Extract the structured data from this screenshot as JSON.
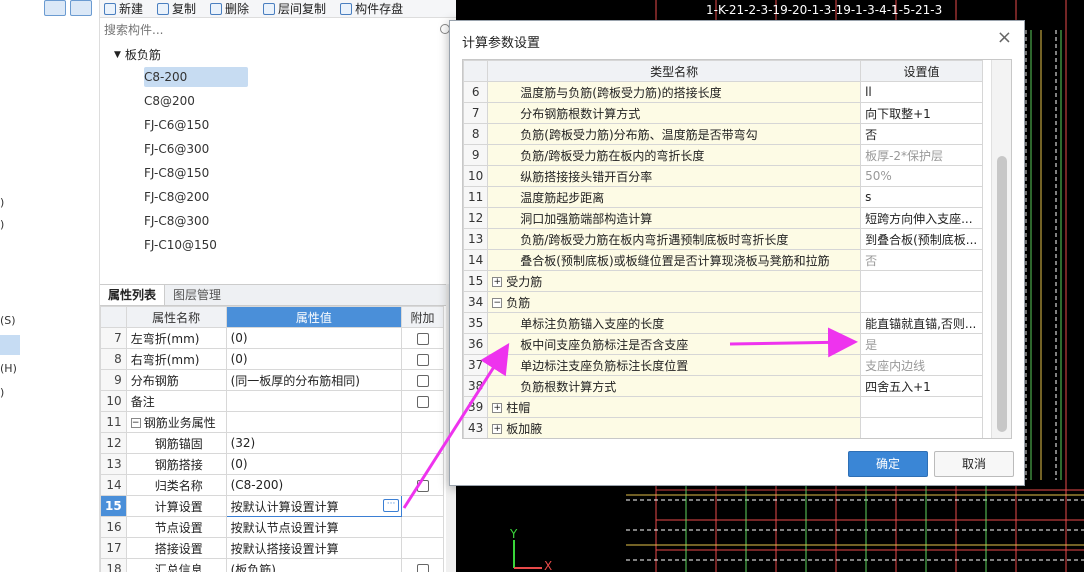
{
  "left_strip": {
    "labels": [
      ")",
      ")",
      "(S)",
      "(H)",
      ")"
    ]
  },
  "toolbar": {
    "new_label": "新建",
    "copy_label": "复制",
    "delete_label": "删除",
    "floor_copy_label": "层间复制",
    "save_label": "构件存盘"
  },
  "search": {
    "placeholder": "搜索构件..."
  },
  "tree": {
    "root_label": "板负筋",
    "items": [
      "C8-200",
      "C8@200",
      "FJ-C6@150",
      "FJ-C6@300",
      "FJ-C8@150",
      "FJ-C8@200",
      "FJ-C8@300",
      "FJ-C10@150"
    ],
    "selected_index": 0
  },
  "props": {
    "tabs": [
      "属性列表",
      "图层管理"
    ],
    "headers": {
      "name": "属性名称",
      "value": "属性值",
      "extra": "附加"
    },
    "rows": [
      {
        "num": "7",
        "name": "左弯折(mm)",
        "value": "(0)"
      },
      {
        "num": "8",
        "name": "右弯折(mm)",
        "value": "(0)"
      },
      {
        "num": "9",
        "name": "分布钢筋",
        "value": "(同一板厚的分布筋相同)"
      },
      {
        "num": "10",
        "name": "备注",
        "value": ""
      },
      {
        "num": "11",
        "name": "钢筋业务属性",
        "value": ""
      },
      {
        "num": "12",
        "name": "钢筋锚固",
        "value": "(32)"
      },
      {
        "num": "13",
        "name": "钢筋搭接",
        "value": "(0)"
      },
      {
        "num": "14",
        "name": "归类名称",
        "value": "(C8-200)"
      },
      {
        "num": "15",
        "name": "计算设置",
        "value": "按默认计算设置计算"
      },
      {
        "num": "16",
        "name": "节点设置",
        "value": "按默认节点设置计算"
      },
      {
        "num": "17",
        "name": "搭接设置",
        "value": "按默认搭接设置计算"
      },
      {
        "num": "18",
        "name": "汇总信息",
        "value": "(板负筋)"
      }
    ],
    "ellipsis": "···"
  },
  "dialog": {
    "title": "计算参数设置",
    "close": "×",
    "headers": {
      "type": "类型名称",
      "value": "设置值"
    },
    "rows": [
      {
        "num": "6",
        "name": "温度筋与负筋(跨板受力筋)的搭接长度",
        "value": "ll"
      },
      {
        "num": "7",
        "name": "分布钢筋根数计算方式",
        "value": "向下取整+1"
      },
      {
        "num": "8",
        "name": "负筋(跨板受力筋)分布筋、温度筋是否带弯勾",
        "value": "否"
      },
      {
        "num": "9",
        "name": "负筋/跨板受力筋在板内的弯折长度",
        "value": "板厚-2*保护层"
      },
      {
        "num": "10",
        "name": "纵筋搭接接头错开百分率",
        "value": "50%"
      },
      {
        "num": "11",
        "name": "温度筋起步距离",
        "value": "s"
      },
      {
        "num": "12",
        "name": "洞口加强筋端部构造计算",
        "value": "短跨方向伸入支座..."
      },
      {
        "num": "13",
        "name": "负筋/跨板受力筋在板内弯折遇预制底板时弯折长度",
        "value": "到叠合板(预制底板..."
      },
      {
        "num": "14",
        "name": "叠合板(预制底板)或板缝位置是否计算现浇板马凳筋和拉筋",
        "value": "否"
      },
      {
        "num": "15",
        "name": "受力筋",
        "value": ""
      },
      {
        "num": "34",
        "name": "负筋",
        "value": ""
      },
      {
        "num": "35",
        "name": "单标注负筋锚入支座的长度",
        "value": "能直锚就直锚,否则..."
      },
      {
        "num": "36",
        "name": "板中间支座负筋标注是否含支座",
        "value": "是"
      },
      {
        "num": "37",
        "name": "单边标注支座负筋标注长度位置",
        "value": "支座内边线"
      },
      {
        "num": "38",
        "name": "负筋根数计算方式",
        "value": "四舍五入+1"
      },
      {
        "num": "39",
        "name": "柱帽",
        "value": ""
      },
      {
        "num": "43",
        "name": "板加腋",
        "value": ""
      }
    ],
    "plus": "+",
    "minus": "−",
    "ok_label": "确定",
    "cancel_label": "取消"
  },
  "viewport": {
    "top_text": "1-K-21-2-3-19-20-1-3-19-1-3-4-1-5-21-3",
    "axis_y": "Y",
    "axis_x": "X"
  },
  "colors": {
    "accent": "#3a86d6",
    "highlight_row": "#c7dcf2",
    "type_cell_bg": "#fdfbe5",
    "arrow": "#ee33ee"
  }
}
